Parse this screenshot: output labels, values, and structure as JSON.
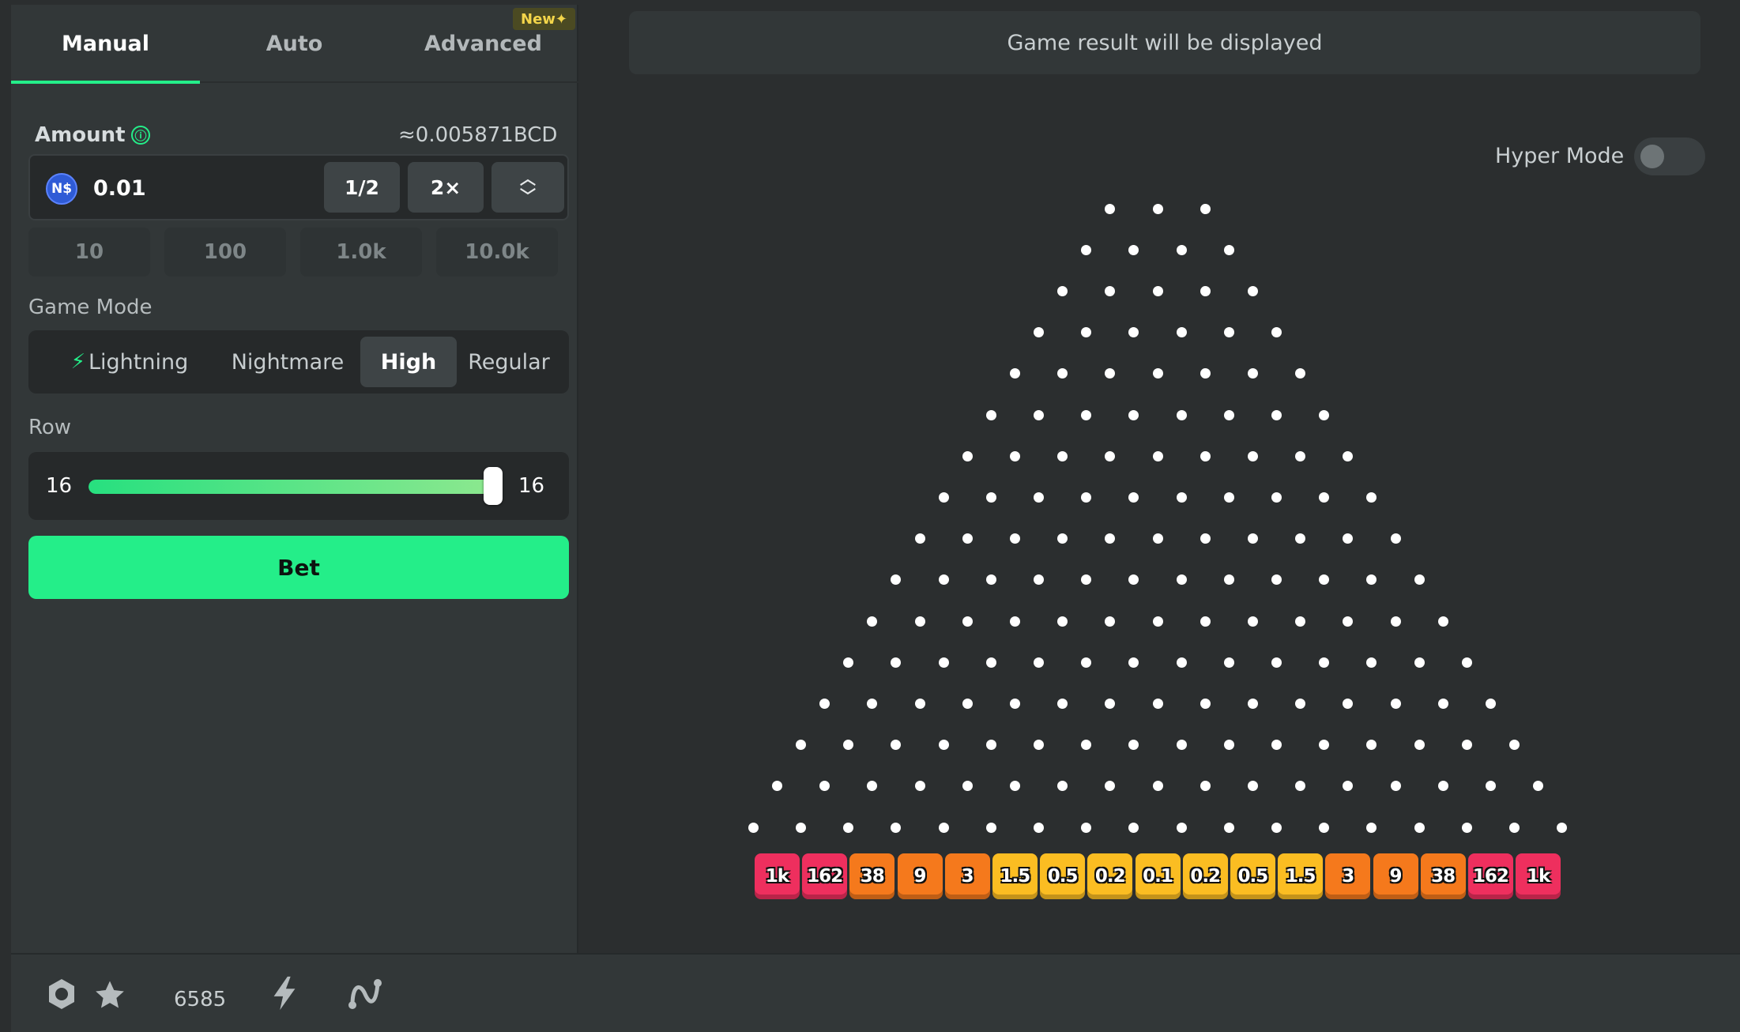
{
  "tabs": [
    {
      "label": "Manual"
    },
    {
      "label": "Auto"
    },
    {
      "label": "Advanced"
    }
  ],
  "new_badge": "New✦",
  "amount": {
    "label": "Amount",
    "info_icon": "ⓘ",
    "conversion": "≈0.005871BCD",
    "currency_symbol": "N$",
    "value": "0.01",
    "half_label": "1/2",
    "double_label": "2×",
    "quick_amounts": [
      "10",
      "100",
      "1.0k",
      "10.0k"
    ]
  },
  "game_mode": {
    "label": "Game Mode",
    "options": [
      "Lightning",
      "Nightmare",
      "High",
      "Regular"
    ],
    "selected": "High"
  },
  "row": {
    "label": "Row",
    "min_display": "16",
    "max_display": "16",
    "value": 16,
    "fill_fraction": 1.0
  },
  "bet_label": "Bet",
  "result_text": "Game result will be displayed",
  "hyper_mode": {
    "label": "Hyper Mode",
    "enabled": false
  },
  "board": {
    "rows": 16,
    "first_row_pegs": 3,
    "multipliers": [
      "1k",
      "162",
      "38",
      "9",
      "3",
      "1.5",
      "0.5",
      "0.2",
      "0.1",
      "0.2",
      "0.5",
      "1.5",
      "3",
      "9",
      "38",
      "162",
      "1k"
    ]
  },
  "bottom_bar": {
    "icons": [
      "settings-icon",
      "star-icon",
      "lightning-icon",
      "chart-curve-icon"
    ],
    "star_count": "6585"
  },
  "colors": {
    "accent": "#24ee89",
    "bucket_red": "#ee2f5e",
    "bucket_orange": "#f5791c",
    "bucket_yellow": "#fbbd22"
  }
}
